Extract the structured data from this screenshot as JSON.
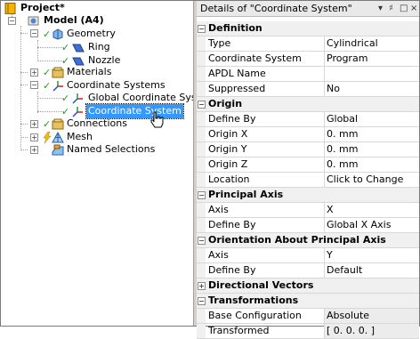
{
  "tree": {
    "project": "Project*",
    "model": "Model (A4)",
    "geometry": "Geometry",
    "ring": "Ring",
    "nozzle": "Nozzle",
    "materials": "Materials",
    "coordinate_systems": "Coordinate Systems",
    "global_cs": "Global Coordinate System",
    "cs": "Coordinate System",
    "connections": "Connections",
    "mesh": "Mesh",
    "named_selections": "Named Selections"
  },
  "details": {
    "title": "Details of \"Coordinate System\"",
    "title_buttons": [
      "▾",
      "♯",
      "□",
      "×"
    ],
    "sections": [
      {
        "label": "Definition",
        "expanded": true,
        "rows": [
          {
            "name": "Type",
            "value": "Cylindrical"
          },
          {
            "name": "Coordinate System",
            "value": "Program Controlled"
          },
          {
            "name": "APDL Name",
            "value": ""
          },
          {
            "name": "Suppressed",
            "value": "No"
          }
        ]
      },
      {
        "label": "Origin",
        "expanded": true,
        "rows": [
          {
            "name": "Define By",
            "value": "Global Coordinates"
          },
          {
            "name": "Origin X",
            "value": "0. mm"
          },
          {
            "name": "Origin Y",
            "value": "0. mm"
          },
          {
            "name": "Origin Z",
            "value": "0. mm"
          },
          {
            "name": "Location",
            "value": "Click to Change"
          }
        ]
      },
      {
        "label": "Principal Axis",
        "expanded": true,
        "rows": [
          {
            "name": "Axis",
            "value": "X"
          },
          {
            "name": "Define By",
            "value": "Global X Axis"
          }
        ]
      },
      {
        "label": "Orientation About Principal Axis",
        "expanded": true,
        "rows": [
          {
            "name": "Axis",
            "value": "Y"
          },
          {
            "name": "Define By",
            "value": "Default"
          }
        ]
      },
      {
        "label": "Directional Vectors",
        "expanded": false,
        "rows": []
      },
      {
        "label": "Transformations",
        "expanded": true,
        "rows": [
          {
            "name": "Base Configuration",
            "value": "Absolute"
          },
          {
            "name": "Transformed Configuration",
            "value": "[ 0. 0. 0. ]"
          }
        ]
      }
    ]
  },
  "colors": {
    "selection": "#3399ff",
    "check": "#1e9b1e",
    "header_bg": "#f0f0f0"
  }
}
